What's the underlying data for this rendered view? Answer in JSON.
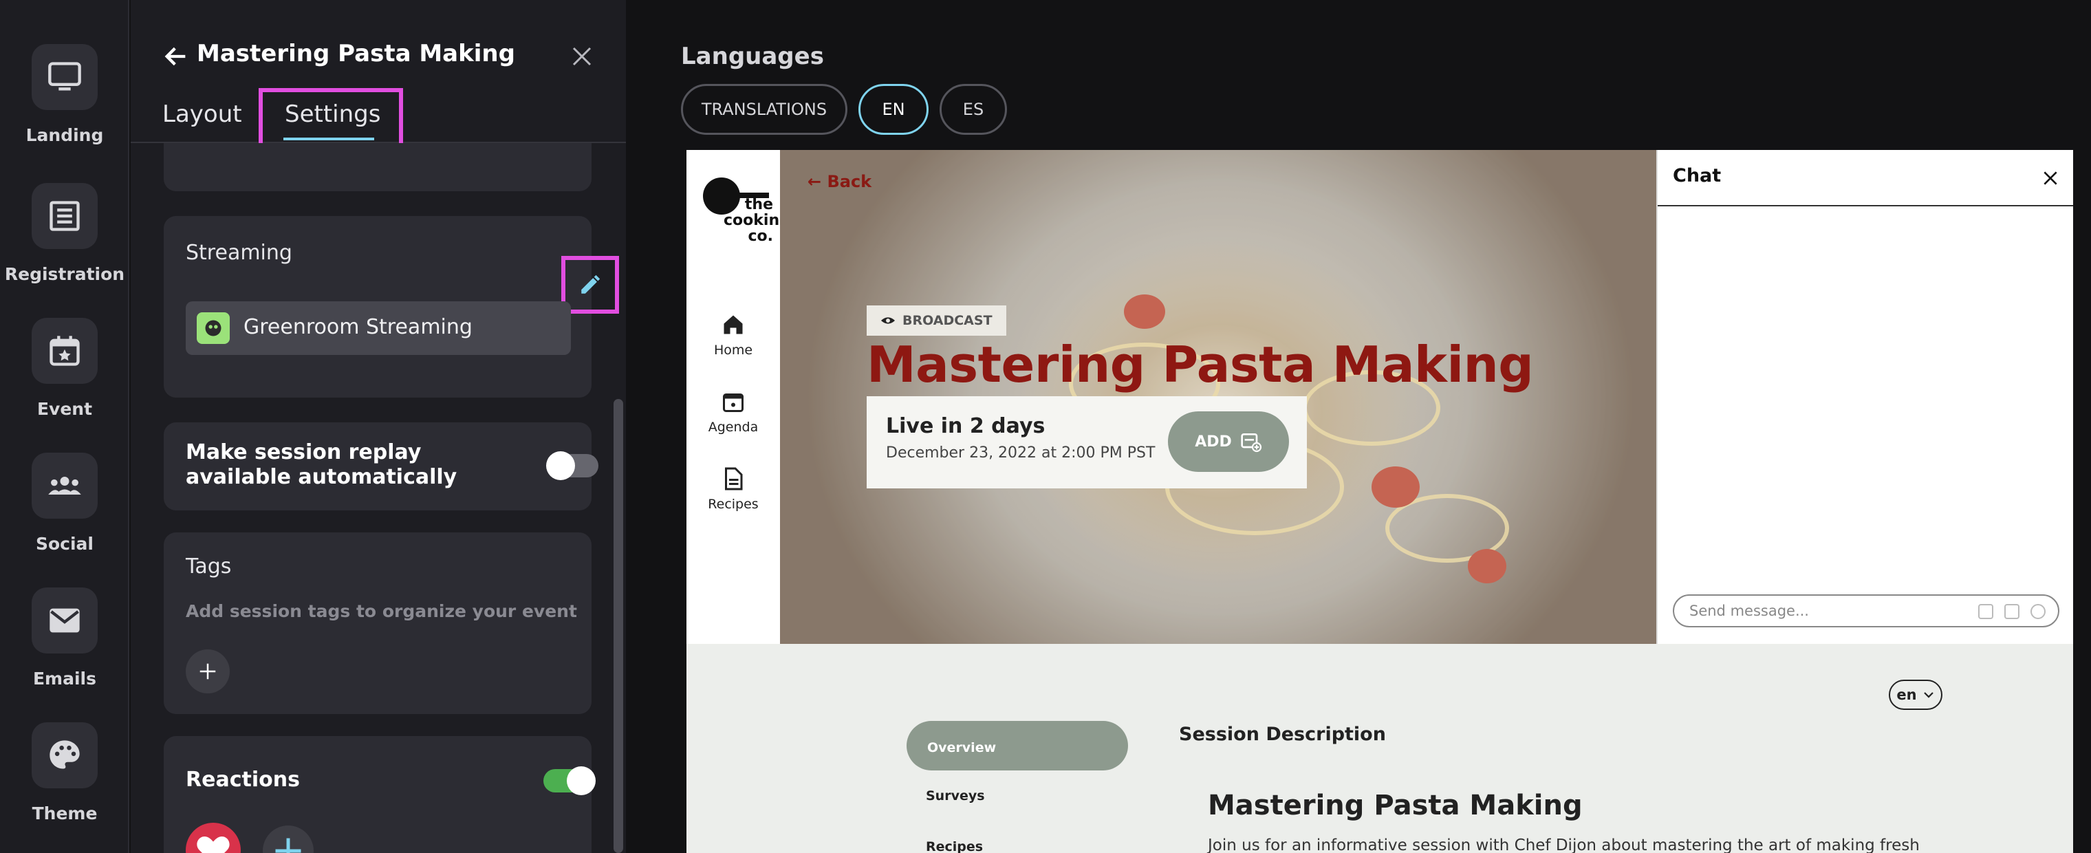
{
  "rail": {
    "items": [
      {
        "label": "Landing",
        "icon": "monitor-icon"
      },
      {
        "label": "Registration",
        "icon": "form-icon"
      },
      {
        "label": "Event",
        "icon": "calendar-star-icon"
      },
      {
        "label": "Social",
        "icon": "people-icon"
      },
      {
        "label": "Emails",
        "icon": "mail-icon"
      },
      {
        "label": "Theme",
        "icon": "palette-icon"
      }
    ]
  },
  "panel": {
    "title": "Mastering Pasta Making",
    "tabs": [
      {
        "label": "Layout",
        "active": false
      },
      {
        "label": "Settings",
        "active": true
      }
    ],
    "streaming": {
      "title": "Streaming",
      "provider": "Greenroom Streaming"
    },
    "replay": {
      "label": "Make session replay available automatically",
      "enabled": false
    },
    "tags": {
      "title": "Tags",
      "help": "Add session tags to organize your event"
    },
    "reactions": {
      "title": "Reactions",
      "enabled": true
    }
  },
  "languages": {
    "title": "Languages",
    "pills": [
      "TRANSLATIONS",
      "EN",
      "ES"
    ],
    "selected": "EN"
  },
  "preview": {
    "logo_text": "the cooking co.",
    "nav": [
      {
        "label": "Home",
        "icon": "home-icon"
      },
      {
        "label": "Agenda",
        "icon": "calendar-icon"
      },
      {
        "label": "Recipes",
        "icon": "document-icon"
      }
    ],
    "back_label": "Back",
    "badge": "BROADCAST",
    "session_title": "Mastering Pasta Making",
    "live_title": "Live in 2 days",
    "live_date": "December 23, 2022 at 2:00 PM PST",
    "add_label": "ADD",
    "chat": {
      "title": "Chat",
      "placeholder": "Send message..."
    },
    "lang_select": "en",
    "side_menu": [
      "Overview",
      "Surveys",
      "Recipes"
    ],
    "description_heading": "Session Description",
    "description_title": "Mastering Pasta Making",
    "description_text": "Join us for an informative session with Chef Dijon about mastering the art of making fresh"
  },
  "colors": {
    "accent": "#7fd3ee",
    "highlight": "#e14ee0",
    "brand_red": "#8e1812",
    "sage": "#8d9a8e",
    "toggle_on": "#4caf50"
  }
}
